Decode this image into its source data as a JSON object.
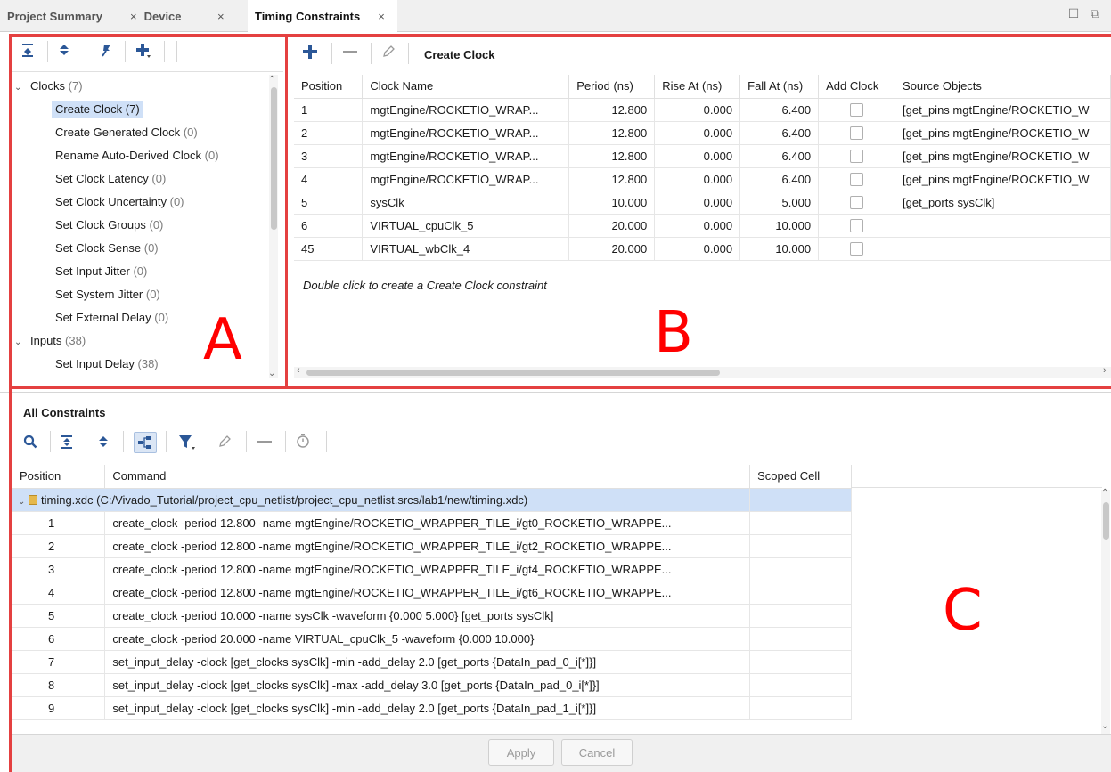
{
  "tabs": [
    {
      "label": "Project Summary"
    },
    {
      "label": "Device"
    },
    {
      "label": "Timing Constraints"
    }
  ],
  "tab_close": "×",
  "window": {
    "restore": "☐",
    "float": "⧉"
  },
  "panel_labels": {
    "a": "A",
    "b": "B",
    "c": "C"
  },
  "tree": {
    "items": [
      {
        "label": "Clocks",
        "count": "(7)",
        "group": true
      },
      {
        "label": "Create Clock",
        "count": "(7)",
        "selected": true
      },
      {
        "label": "Create Generated Clock",
        "count": "(0)"
      },
      {
        "label": "Rename Auto-Derived Clock",
        "count": "(0)"
      },
      {
        "label": "Set Clock Latency",
        "count": "(0)"
      },
      {
        "label": "Set Clock Uncertainty",
        "count": "(0)"
      },
      {
        "label": "Set Clock Groups",
        "count": "(0)"
      },
      {
        "label": "Set Clock Sense",
        "count": "(0)"
      },
      {
        "label": "Set Input Jitter",
        "count": "(0)"
      },
      {
        "label": "Set System Jitter",
        "count": "(0)"
      },
      {
        "label": "Set External Delay",
        "count": "(0)"
      },
      {
        "label": "Inputs",
        "count": "(38)",
        "group": true
      },
      {
        "label": "Set Input Delay",
        "count": "(38)"
      }
    ]
  },
  "clock_panel": {
    "title": "Create Clock",
    "columns": [
      "Position",
      "Clock Name",
      "Period (ns)",
      "Rise At (ns)",
      "Fall At (ns)",
      "Add Clock",
      "Source Objects"
    ],
    "rows": [
      {
        "position": "1",
        "name": "mgtEngine/ROCKETIO_WRAP...",
        "period": "12.800",
        "rise": "0.000",
        "fall": "6.400",
        "source": "[get_pins mgtEngine/ROCKETIO_W"
      },
      {
        "position": "2",
        "name": "mgtEngine/ROCKETIO_WRAP...",
        "period": "12.800",
        "rise": "0.000",
        "fall": "6.400",
        "source": "[get_pins mgtEngine/ROCKETIO_W"
      },
      {
        "position": "3",
        "name": "mgtEngine/ROCKETIO_WRAP...",
        "period": "12.800",
        "rise": "0.000",
        "fall": "6.400",
        "source": "[get_pins mgtEngine/ROCKETIO_W"
      },
      {
        "position": "4",
        "name": "mgtEngine/ROCKETIO_WRAP...",
        "period": "12.800",
        "rise": "0.000",
        "fall": "6.400",
        "source": "[get_pins mgtEngine/ROCKETIO_W"
      },
      {
        "position": "5",
        "name": "sysClk",
        "period": "10.000",
        "rise": "0.000",
        "fall": "5.000",
        "source": "[get_ports sysClk]"
      },
      {
        "position": "6",
        "name": "VIRTUAL_cpuClk_5",
        "period": "20.000",
        "rise": "0.000",
        "fall": "10.000",
        "source": ""
      },
      {
        "position": "45",
        "name": "VIRTUAL_wbClk_4",
        "period": "20.000",
        "rise": "0.000",
        "fall": "10.000",
        "source": ""
      }
    ],
    "hint": "Double click to create a Create Clock constraint"
  },
  "all_constraints": {
    "title": "All Constraints",
    "columns": [
      "Position",
      "Command",
      "Scoped Cell"
    ],
    "file_row": "timing.xdc (C:/Vivado_Tutorial/project_cpu_netlist/project_cpu_netlist.srcs/lab1/new/timing.xdc)",
    "rows": [
      {
        "position": "1",
        "command": "create_clock -period 12.800 -name mgtEngine/ROCKETIO_WRAPPER_TILE_i/gt0_ROCKETIO_WRAPPE..."
      },
      {
        "position": "2",
        "command": "create_clock -period 12.800 -name mgtEngine/ROCKETIO_WRAPPER_TILE_i/gt2_ROCKETIO_WRAPPE..."
      },
      {
        "position": "3",
        "command": "create_clock -period 12.800 -name mgtEngine/ROCKETIO_WRAPPER_TILE_i/gt4_ROCKETIO_WRAPPE..."
      },
      {
        "position": "4",
        "command": "create_clock -period 12.800 -name mgtEngine/ROCKETIO_WRAPPER_TILE_i/gt6_ROCKETIO_WRAPPE..."
      },
      {
        "position": "5",
        "command": "create_clock -period 10.000 -name sysClk -waveform {0.000 5.000} [get_ports sysClk]"
      },
      {
        "position": "6",
        "command": "create_clock -period 20.000 -name VIRTUAL_cpuClk_5 -waveform {0.000 10.000}"
      },
      {
        "position": "7",
        "command": "set_input_delay -clock [get_clocks sysClk] -min -add_delay 2.0 [get_ports {DataIn_pad_0_i[*]}]"
      },
      {
        "position": "8",
        "command": "set_input_delay -clock [get_clocks sysClk] -max -add_delay 3.0 [get_ports {DataIn_pad_0_i[*]}]"
      },
      {
        "position": "9",
        "command": "set_input_delay -clock [get_clocks sysClk] -min -add_delay 2.0 [get_ports {DataIn_pad_1_i[*]}]"
      }
    ],
    "apply_label": "Apply",
    "cancel_label": "Cancel"
  }
}
